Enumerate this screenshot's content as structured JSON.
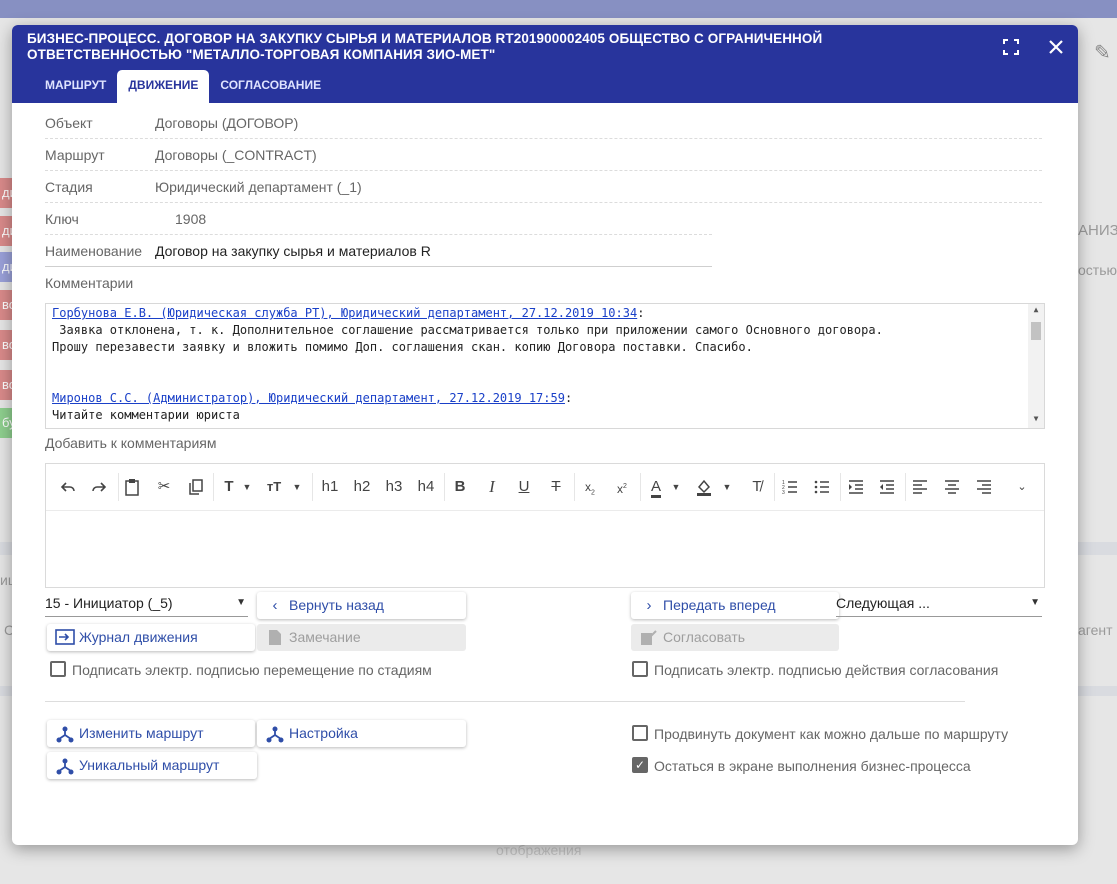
{
  "dialog": {
    "title": "Бизнес-процесс. Договор на закупку сырья и материалов RT201900002405 Общество с ограниченной ответственностью \"Металло-торговая компания ЗИО-МЕТ\"",
    "fullscreen_icon": "fullscreen-icon",
    "close_icon": "close-icon",
    "tabs": [
      {
        "label": "МАРШРУТ"
      },
      {
        "label": "ДВИЖЕНИЕ"
      },
      {
        "label": "СОГЛАСОВАНИЕ"
      }
    ],
    "active_tab": "ДВИЖЕНИЕ"
  },
  "fields": {
    "object": {
      "label": "Объект",
      "value": "Договоры (ДОГОВОР)"
    },
    "route": {
      "label": "Маршрут",
      "value": "Договоры (_CONTRACT)"
    },
    "stage": {
      "label": "Стадия",
      "value": "Юридический департамент (_1)"
    },
    "key": {
      "label": "Ключ",
      "value": "1908"
    },
    "name": {
      "label": "Наименование",
      "value": "Договор на закупку сырья и материалов  R"
    }
  },
  "comments": {
    "label": "Комментарии",
    "entries": [
      {
        "author": "Горбунова Е.В. (Юридическая служба РТ), Юридический департамент, 27.12.2019 10:34",
        "lines": [
          " Заявка отклонена, т. к. Дополнительное соглашение рассматривается только при приложении самого Основного договора.",
          "Прошу перезавести заявку и вложить помимо Доп. соглашения скан. копию Договора поставки. Спасибо."
        ]
      },
      {
        "author": "Миронов С.С. (Администратор), Юридический департамент, 27.12.2019 17:59",
        "lines": [
          "Читайте комментарии юриста"
        ]
      }
    ]
  },
  "add_comment": {
    "label": "Добавить к комментариям"
  },
  "toolbar": {
    "h1": "h1",
    "h2": "h2",
    "h3": "h3",
    "h4": "h4",
    "bold": "B",
    "italic": "I",
    "underline": "U"
  },
  "stage_select": {
    "value": "15 - Инициатор (_5)"
  },
  "next_select": {
    "value": "Следующая ..."
  },
  "buttons": {
    "back": "Вернуть назад",
    "forward": "Передать вперед",
    "journal": "Журнал движения",
    "remark": "Замечание",
    "approve": "Согласовать",
    "change_route": "Изменить маршрут",
    "settings": "Настройка",
    "unique_route": "Уникальный маршрут"
  },
  "checkboxes": {
    "sign_stages": {
      "label": "Подписать электр. подписью перемещение по стадиям",
      "checked": false
    },
    "sign_approval": {
      "label": "Подписать электр. подписью действия согласования",
      "checked": false
    },
    "advance_doc": {
      "label": "Продвинуть документ как можно дальше по маршруту",
      "checked": false
    },
    "stay_screen": {
      "label": "Остаться в экране выполнения бизнес-процесса",
      "checked": true
    }
  },
  "background": {
    "right_text_1": "АНИЗА",
    "right_text_2": "остью",
    "right_text_3": "агент",
    "left_text_1": "иц",
    "left_text_2": "С",
    "bottom_text": "отображения",
    "left_strip_labels": [
      "ди",
      "ди",
      "ди",
      "во",
      "во",
      "во",
      "бу"
    ],
    "left_strip_colors": [
      "#d98a8a",
      "#d98a8a",
      "#9aa0d8",
      "#d98a8a",
      "#d98a8a",
      "#d98a8a",
      "#8ecf8e"
    ],
    "pencil_icon": "pencil-icon"
  }
}
